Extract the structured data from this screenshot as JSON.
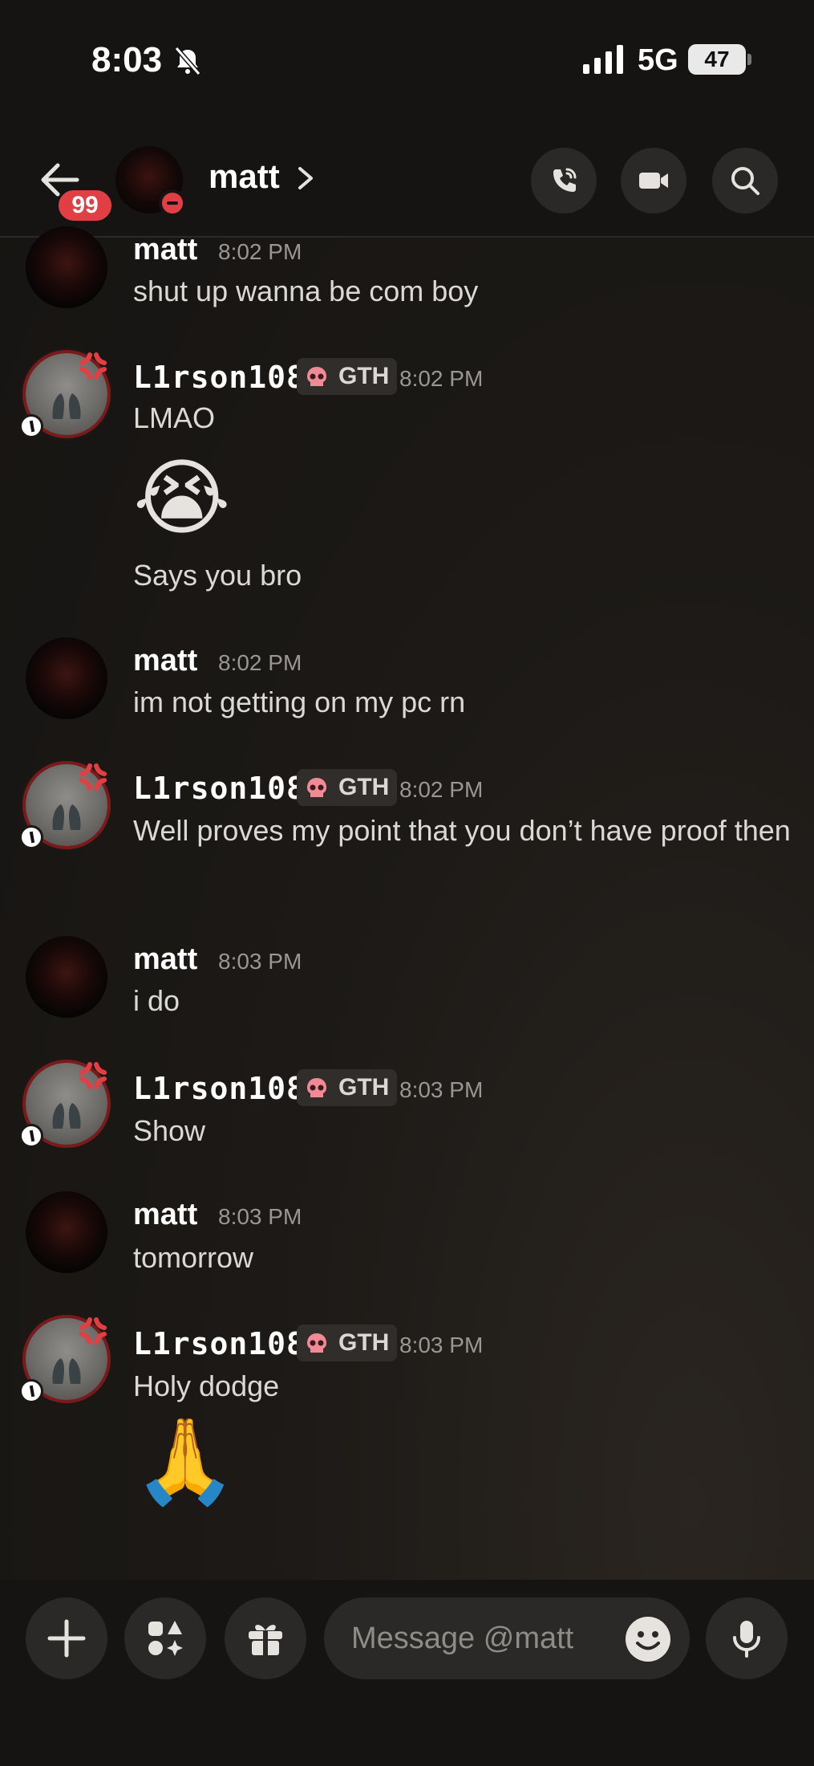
{
  "status_bar": {
    "time": "8:03",
    "network": "5G",
    "battery": "47"
  },
  "header": {
    "unread_badge": "99",
    "channel_name": "matt"
  },
  "messages": [
    {
      "author": "matt",
      "time": "8:02 PM",
      "lines": [
        "shut up wanna be com boy"
      ]
    },
    {
      "author": "L1rson108",
      "tag": "GTH",
      "time": "8:02 PM",
      "lines": [
        "LMAO",
        "😭",
        "Says you bro"
      ]
    },
    {
      "author": "matt",
      "time": "8:02 PM",
      "lines": [
        "im not getting on my pc rn"
      ]
    },
    {
      "author": "L1rson108",
      "tag": "GTH",
      "time": "8:02 PM",
      "lines": [
        "Well proves my point that you don’t have proof then"
      ]
    },
    {
      "author": "matt",
      "time": "8:03 PM",
      "lines": [
        "i do"
      ]
    },
    {
      "author": "L1rson108",
      "tag": "GTH",
      "time": "8:03 PM",
      "lines": [
        "Show"
      ]
    },
    {
      "author": "matt",
      "time": "8:03 PM",
      "lines": [
        "tomorrow"
      ]
    },
    {
      "author": "L1rson108",
      "tag": "GTH",
      "time": "8:03 PM",
      "lines": [
        "Holy dodge",
        "🙏"
      ]
    }
  ],
  "composer": {
    "placeholder": "Message @matt"
  },
  "colors": {
    "accent_red": "#e23f45",
    "background": "#1a1715"
  }
}
